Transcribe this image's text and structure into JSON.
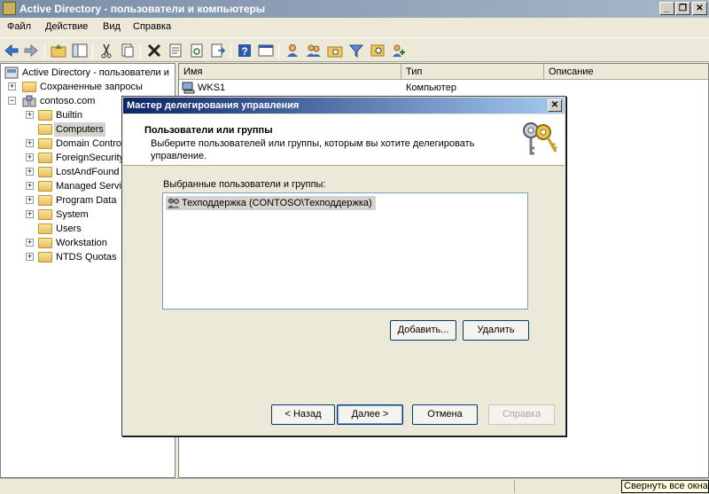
{
  "window": {
    "title": "Active Directory - пользователи и компьютеры"
  },
  "menu": {
    "items": [
      "Файл",
      "Действие",
      "Вид",
      "Справка"
    ]
  },
  "tree": {
    "root": "Active Directory - пользователи и",
    "saved_queries": "Сохраненные запросы",
    "domain": "contoso.com",
    "items": [
      "Builtin",
      "Computers",
      "Domain Control",
      "ForeignSecurity",
      "LostAndFound",
      "Managed Servic",
      "Program Data",
      "System",
      "Users",
      "Workstation",
      "NTDS Quotas"
    ],
    "selected": "Computers"
  },
  "list": {
    "columns": [
      "Имя",
      "Тип",
      "Описание"
    ],
    "rows": [
      {
        "name": "WKS1",
        "type": "Компьютер",
        "description": ""
      }
    ]
  },
  "dialog": {
    "title": "Мастер делегирования управления",
    "header_title": "Пользователи или группы",
    "header_subtitle": "Выберите пользователей или группы, которым вы хотите делегировать управление.",
    "list_label": "Выбранные пользователи и группы:",
    "selected_items": [
      "Техподдержка (CONTOSO\\Техподдержка)"
    ],
    "buttons": {
      "add": "Добавить...",
      "remove": "Удалить",
      "back": "< Назад",
      "next": "Далее >",
      "cancel": "Отмена",
      "help": "Справка"
    }
  },
  "tooltip": "Свернуть все окна",
  "colors": {
    "titlebar": "#7a8ea8",
    "dialog_title": "#0a246a",
    "selection": "#d6d3ce"
  }
}
